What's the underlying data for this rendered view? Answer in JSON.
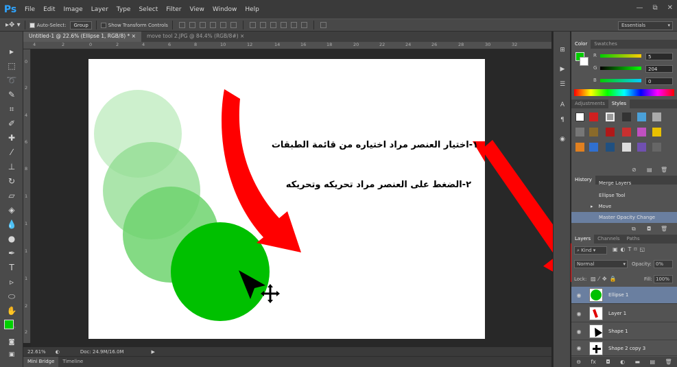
{
  "app": {
    "logo": "Ps",
    "menu": [
      "File",
      "Edit",
      "Image",
      "Layer",
      "Type",
      "Select",
      "Filter",
      "View",
      "Window",
      "Help"
    ],
    "window_controls": [
      "—",
      "⧉",
      "✕"
    ]
  },
  "options_bar": {
    "auto_select_label": "Auto-Select:",
    "auto_select_value": "Group",
    "transform_label": "Show Transform Controls",
    "workspace": "Essentials"
  },
  "document_tabs": [
    "Untitled-1 @ 22.6% (Ellipse 1, RGB/8) * ×",
    "move tool 2.JPG @ 84.4% (RGB/8#) ×"
  ],
  "rulers": {
    "top": [
      "4",
      "2",
      "0",
      "2",
      "4",
      "6",
      "8",
      "10",
      "12",
      "14",
      "16",
      "18",
      "20",
      "22",
      "24",
      "26",
      "28",
      "30",
      "32"
    ],
    "left": [
      "0",
      "2",
      "4",
      "6",
      "8",
      "1",
      "1",
      "1",
      "1",
      "2",
      "2"
    ]
  },
  "canvas": {
    "instruction_1": "١-اختيار العنصر مراد اختياره من قائمة الطبقات",
    "instruction_2": "٢-الضغط على العنصر مراد تحريكه وتحريكه",
    "colors": {
      "circle_light": "#cdf0cd",
      "circle_mid": "#8fdc8f",
      "circle_mid2": "#6fd46f",
      "circle_solid": "#00c000",
      "arrow": "#ff0000"
    }
  },
  "status": {
    "zoom": "22.61%",
    "doc_size": "Doc: 24.9M/16.0M"
  },
  "bottom_tabs": [
    "Mini Bridge",
    "Timeline"
  ],
  "color_panel": {
    "tabs": [
      "Color",
      "Swatches"
    ],
    "r_label": "R",
    "g_label": "G",
    "b_label": "B",
    "r_value": "5",
    "g_value": "204",
    "b_value": "0",
    "foreground": "#05cc00"
  },
  "adjustments_panel": {
    "tabs": [
      "Adjustments",
      "Styles"
    ]
  },
  "history_panel": {
    "title": "History",
    "items": [
      "Merge Layers",
      "Ellipse Tool",
      "Move",
      "Master Opacity Change"
    ]
  },
  "layers_panel": {
    "tabs": [
      "Layers",
      "Channels",
      "Paths"
    ],
    "kind_label": "Kind",
    "blend_mode": "Normal",
    "opacity_label": "Opacity:",
    "opacity_value": "0%",
    "lock_label": "Lock:",
    "fill_label": "Fill:",
    "fill_value": "100%",
    "layers": [
      "Ellipse 1",
      "Layer 1",
      "Shape 1",
      "Shape 2 copy 3"
    ]
  }
}
